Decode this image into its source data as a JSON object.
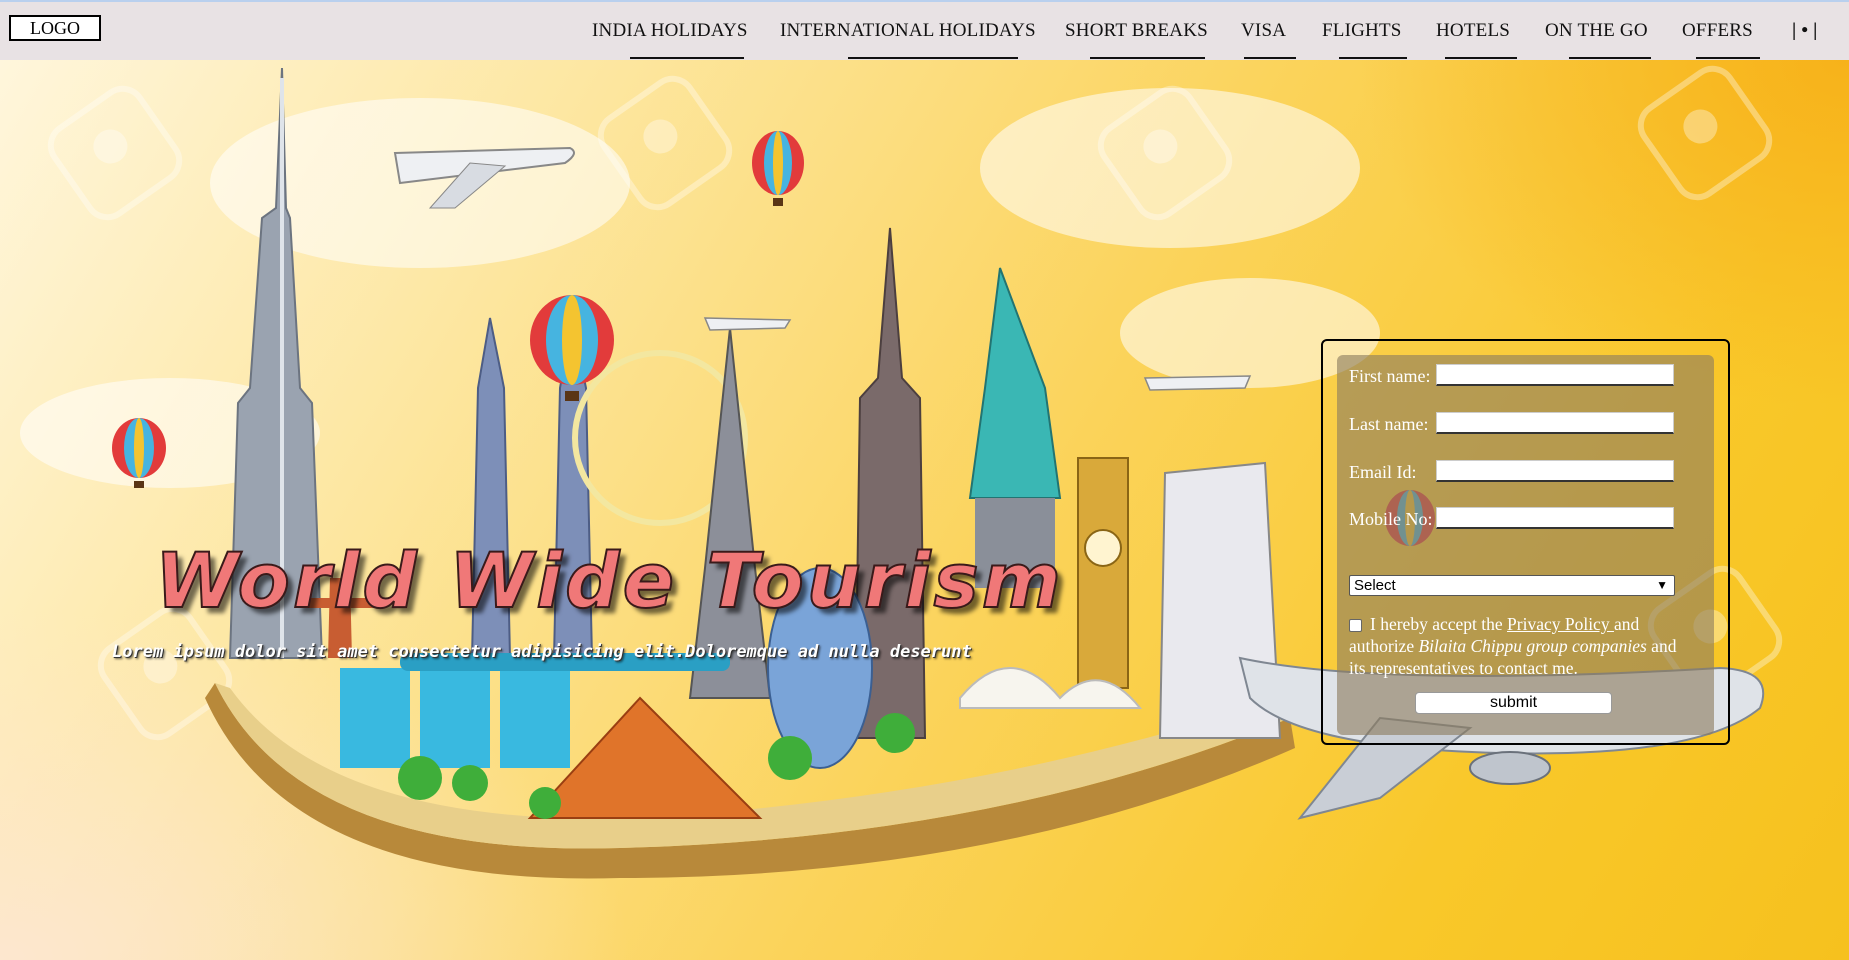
{
  "header": {
    "logo": "LOGO",
    "nav": [
      {
        "label": "INDIA HOLIDAYS"
      },
      {
        "label": "INTERNATIONAL HOLIDAYS"
      },
      {
        "label": "SHORT BREAKS"
      },
      {
        "label": "VISA"
      },
      {
        "label": "FLIGHTS"
      },
      {
        "label": "HOTELS"
      },
      {
        "label": "ON THE GO"
      },
      {
        "label": "OFFERS"
      }
    ],
    "extra": "| • |"
  },
  "hero": {
    "title": "World Wide Tourism",
    "subtitle": "Lorem ipsum dolor sit amet consectetur adipisicing elit.Doloremque ad nulla deserunt"
  },
  "form": {
    "first_name_label": "First name:",
    "last_name_label": "Last name:",
    "email_label": "Email Id:",
    "mobile_label": "Mobile No:",
    "select_value": "Select",
    "consent_prefix": "I hereby accept the ",
    "privacy_link": "Privacy Policy ",
    "consent_mid": "and authorize ",
    "company": "Bilaita Chippu group companies",
    "consent_suffix": " and its representatives to contact me.",
    "submit_label": "submit"
  },
  "colors": {
    "title_pink": "#f07878",
    "header_bg": "#e8e2e4",
    "sky_yellow": "#fbd04a"
  }
}
